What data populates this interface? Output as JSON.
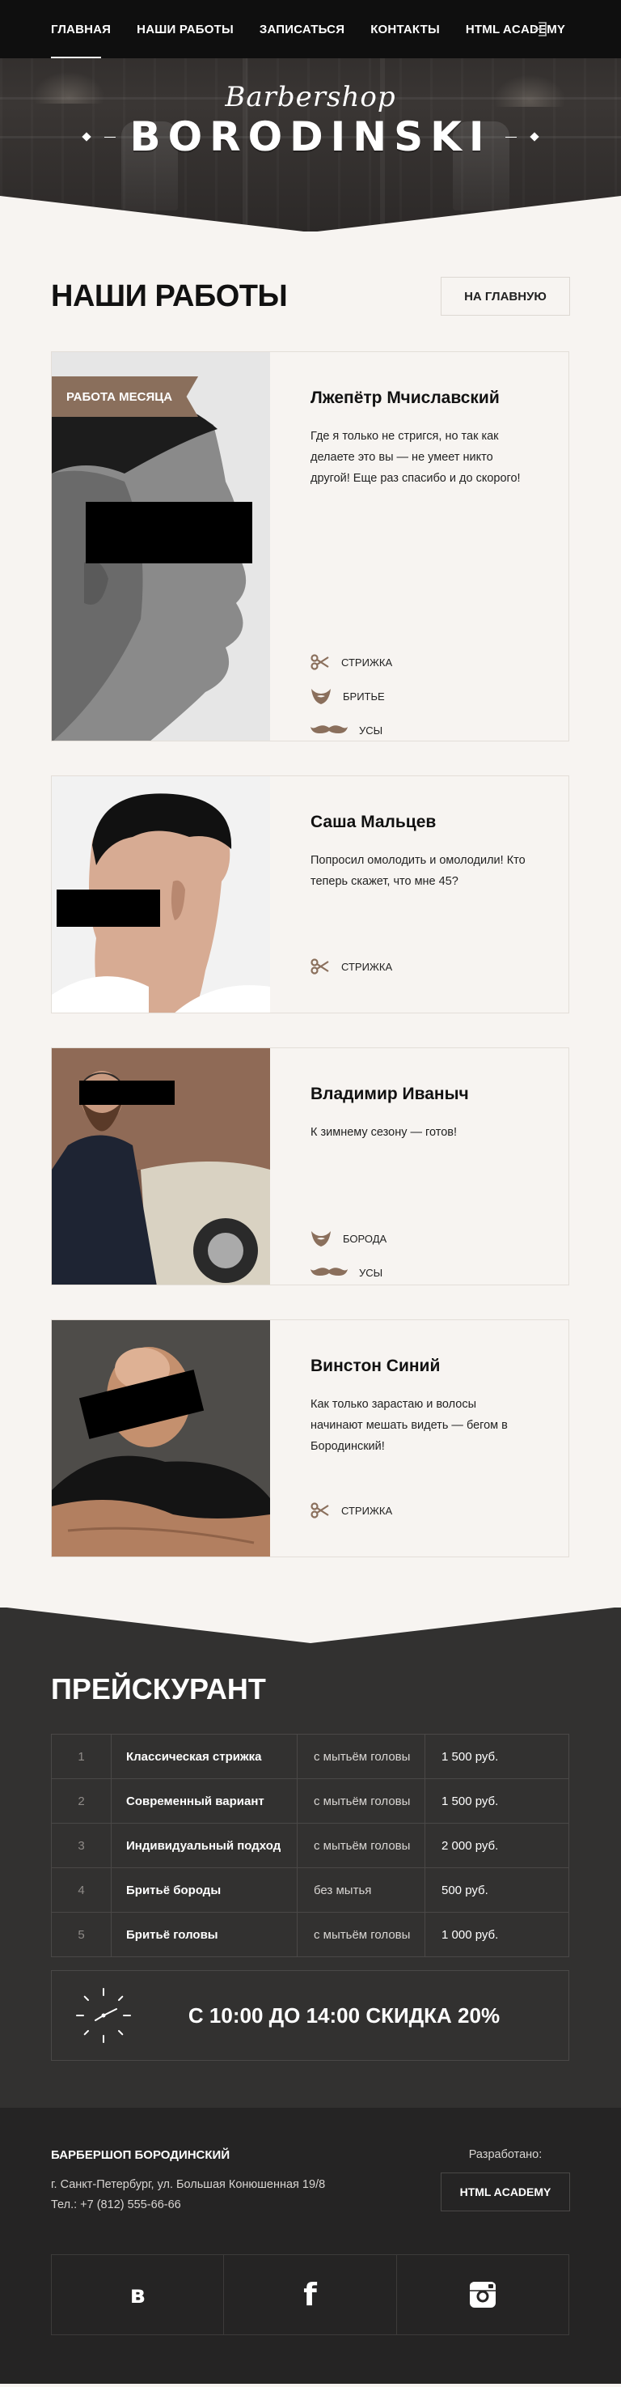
{
  "nav": {
    "items": [
      {
        "label": "ГЛАВНАЯ",
        "active": true
      },
      {
        "label": "НАШИ РАБОТЫ",
        "active": false
      },
      {
        "label": "ЗАПИСАТЬСЯ",
        "active": false
      },
      {
        "label": "КОНТАКТЫ",
        "active": false
      },
      {
        "label": "HTML ACADEMY",
        "active": false
      }
    ],
    "login_icon": "login-icon"
  },
  "logo": {
    "script": "Barbershop",
    "title": "BORODINSKI"
  },
  "page": {
    "title": "НАШИ РАБОТЫ",
    "home_button": "НА ГЛАВНУЮ"
  },
  "works": [
    {
      "badge": "РАБОТА МЕСЯЦА",
      "name": "Лжепётр Мчиславский",
      "text": "Где я только не стригся, но так как делаете это вы — не умеет никто другой! Еще раз спасибо и до скорого!",
      "tags": [
        "СТРИЖКА",
        "БРИТЬЕ",
        "УСЫ"
      ]
    },
    {
      "name": "Саша Мальцев",
      "text": "Попросил омолодить и омолодили! Кто теперь скажет, что мне 45?",
      "tags": [
        "СТРИЖКА"
      ]
    },
    {
      "name": "Владимир Иваныч",
      "text": "К зимнему сезону — готов!",
      "tags": [
        "БОРОДА",
        "УСЫ"
      ]
    },
    {
      "name": "Винстон Синий",
      "text": "Как только зарастаю и волосы начинают мешать видеть — бегом в Бородинский!",
      "tags": [
        "СТРИЖКА"
      ]
    }
  ],
  "prices": {
    "title": "ПРЕЙСКУРАНТ",
    "rows": [
      {
        "num": "1",
        "service": "Классическая стрижка",
        "wash": "с мытьём головы",
        "price": "1 500 руб."
      },
      {
        "num": "2",
        "service": "Современный вариант",
        "wash": "с мытьём головы",
        "price": "1 500 руб."
      },
      {
        "num": "3",
        "service": "Индивидуальный подход",
        "wash": "с мытьём головы",
        "price": "2 000 руб."
      },
      {
        "num": "4",
        "service": "Бритьё бороды",
        "wash": "без мытья",
        "price": "500 руб."
      },
      {
        "num": "5",
        "service": "Бритьё головы",
        "wash": "с мытьём головы",
        "price": "1 000 руб."
      }
    ],
    "discount": "С 10:00 ДО 14:00 СКИДКА 20%"
  },
  "footer": {
    "company": "БАРБЕРШОП БОРОДИНСКИЙ",
    "address": "г. Санкт-Петербург, ул. Большая Конюшенная 19/8",
    "phone": "Тел.: +7 (812) 555-66-66",
    "dev_label": "Разработано:",
    "dev_button": "HTML ACADEMY",
    "socials": [
      {
        "name": "vk",
        "glyph": "в"
      },
      {
        "name": "facebook",
        "glyph": "f"
      },
      {
        "name": "instagram",
        "glyph": ""
      }
    ]
  },
  "colors": {
    "accent": "#8a6f5c",
    "dark": "#323130",
    "footer": "#252424",
    "light_bg": "#f7f4f1"
  }
}
